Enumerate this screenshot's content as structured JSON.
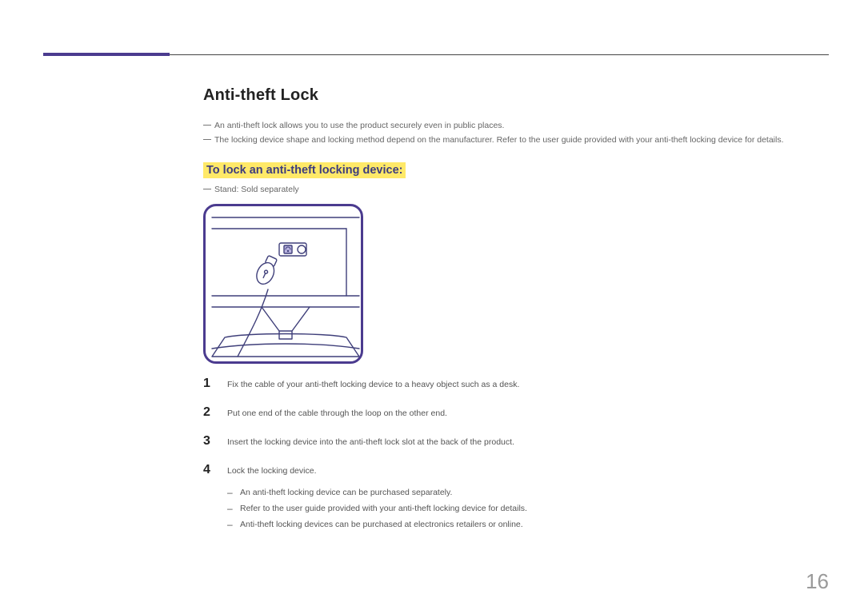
{
  "page_number": "16",
  "heading": "Anti-theft Lock",
  "intro_notes": [
    "An anti-theft lock allows you to use the product securely even in public places.",
    "The locking device shape and locking method depend on the manufacturer. Refer to the user guide provided with your anti-theft locking device for details."
  ],
  "subheading": "To lock an anti-theft locking device:",
  "stand_note": "Stand: Sold separately",
  "steps": [
    {
      "num": "1",
      "text": "Fix the cable of your anti-theft locking device to a heavy object such as a desk."
    },
    {
      "num": "2",
      "text": "Put one end of the cable through the loop on the other end."
    },
    {
      "num": "3",
      "text": "Insert the locking device into the anti-theft lock slot at the back of the product."
    },
    {
      "num": "4",
      "text": "Lock the locking device."
    }
  ],
  "sub_bullets": [
    "An anti-theft locking device can be purchased separately.",
    "Refer to the user guide provided with your anti-theft locking device for details.",
    "Anti-theft locking devices can be purchased at electronics retailers or online."
  ]
}
